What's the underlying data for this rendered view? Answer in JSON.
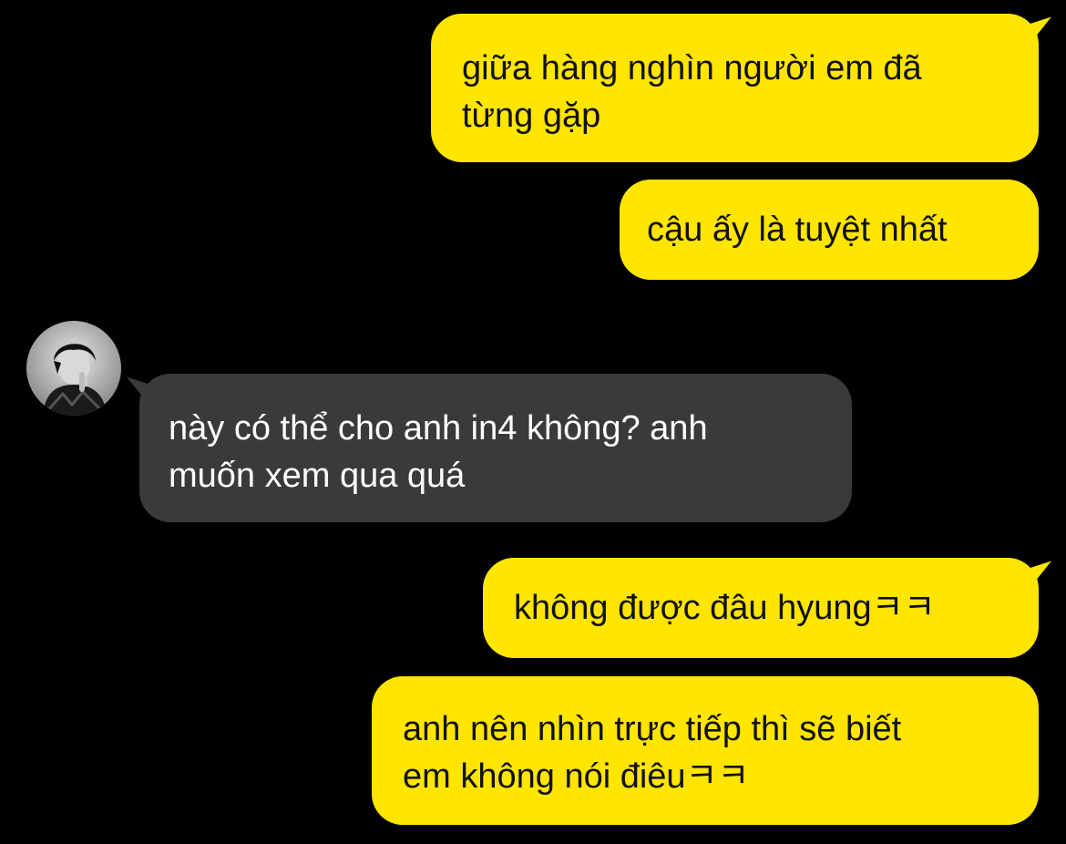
{
  "conversation": {
    "messages": [
      {
        "sender": "me",
        "text": "giữa hàng nghìn người em đã\ntừng gặp"
      },
      {
        "sender": "me",
        "text": "cậu ấy là tuyệt nhất"
      },
      {
        "sender": "other",
        "text": "này có thể cho anh in4 không? anh\nmuốn xem qua quá"
      },
      {
        "sender": "me",
        "text": "không được đâu hyungㅋㅋ"
      },
      {
        "sender": "me",
        "text": "anh nên nhìn trực tiếp thì sẽ biết\nem không nói điêuㅋㅋ"
      }
    ]
  },
  "theme": {
    "background": "#000000",
    "outgoing_bubble": "#FFE500",
    "outgoing_text": "#111111",
    "incoming_bubble": "#3A3A3C",
    "incoming_text": "#FFFFFF"
  },
  "icons": {
    "avatar": "profile-photo-grayscale"
  }
}
